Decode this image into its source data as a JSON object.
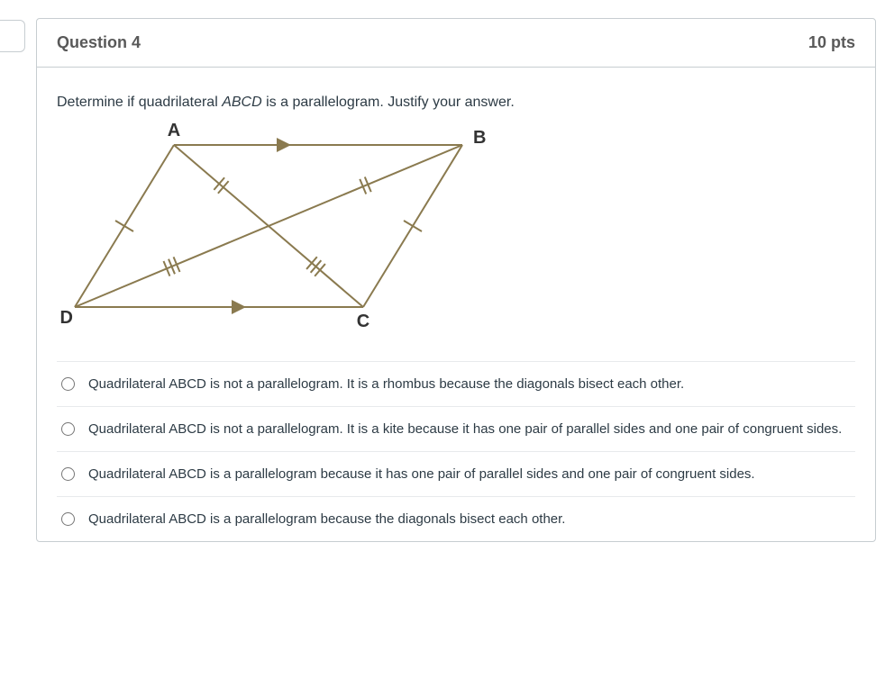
{
  "question": {
    "title": "Question 4",
    "points": "10 pts",
    "prompt_pre": "Determine if quadrilateral ",
    "prompt_ital": "ABCD",
    "prompt_post": " is a parallelogram. Justify your answer.",
    "diagram": {
      "labels": {
        "A": "A",
        "B": "B",
        "C": "C",
        "D": "D"
      }
    },
    "answers": [
      "Quadrilateral ABCD is not a parallelogram. It is a rhombus because the diagonals bisect each other.",
      "Quadrilateral ABCD is not a parallelogram. It is a kite because it has one pair of parallel sides and one pair of congruent sides.",
      "Quadrilateral ABCD is a parallelogram because it has one pair of parallel sides and one pair of congruent sides.",
      "Quadrilateral ABCD is a parallelogram because the diagonals bisect each other."
    ]
  }
}
